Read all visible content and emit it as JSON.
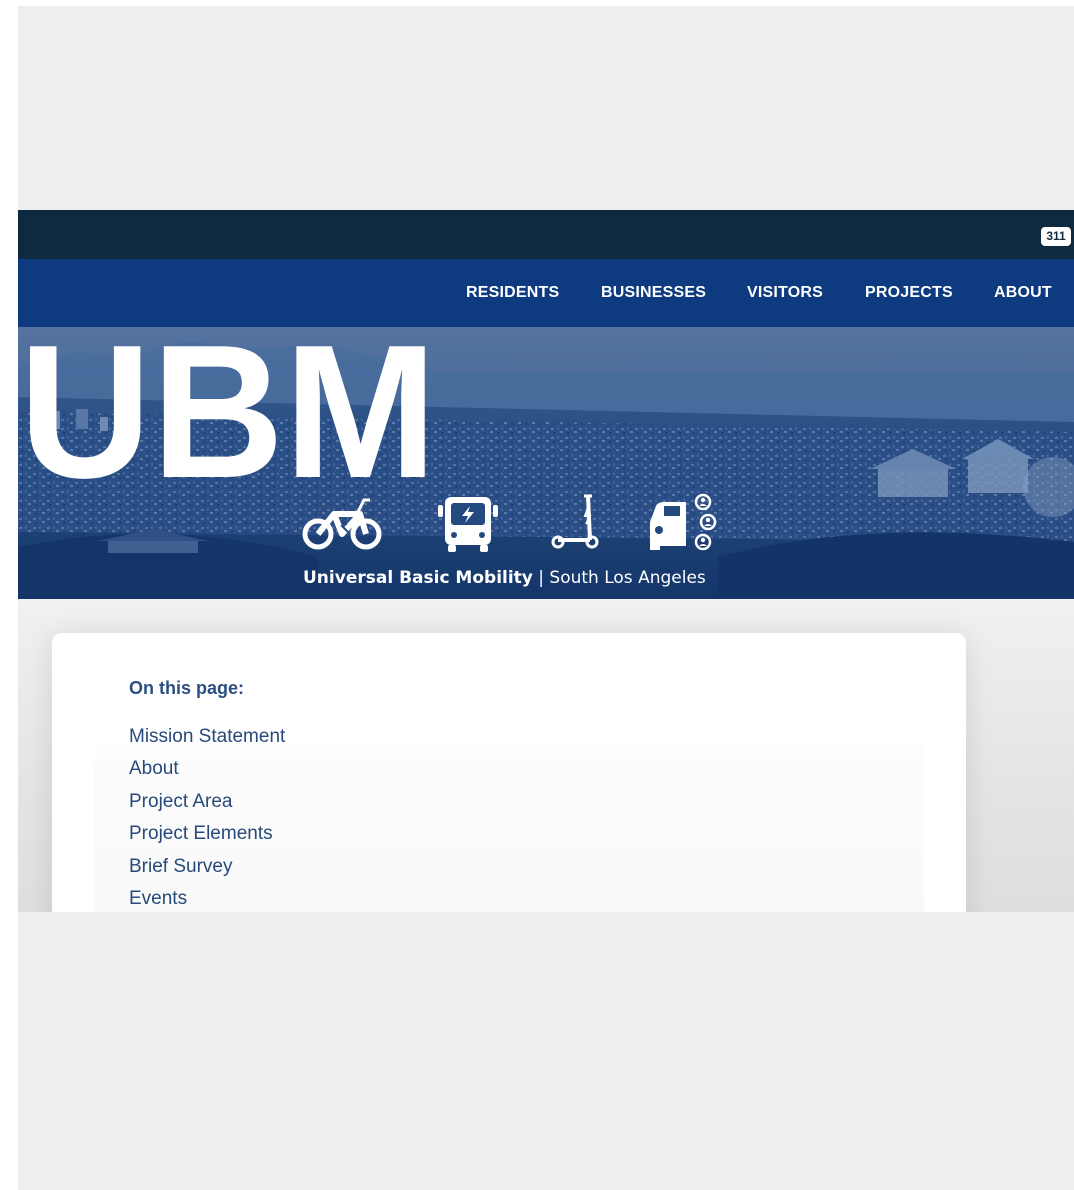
{
  "utility_bar": {
    "badge_311": "311"
  },
  "nav": {
    "items": [
      {
        "label": "RESIDENTS"
      },
      {
        "label": "BUSINESSES"
      },
      {
        "label": "VISITORS"
      },
      {
        "label": "PROJECTS"
      },
      {
        "label": "ABOUT"
      }
    ]
  },
  "hero": {
    "logo_text": "UBM",
    "caption_strong": "Universal Basic Mobility",
    "caption_rest": " | South Los Angeles",
    "icons": [
      "ebike-icon",
      "electric-bus-icon",
      "electric-scooter-icon",
      "car-share-icon"
    ]
  },
  "toc": {
    "title": "On this page:",
    "links": [
      {
        "label": "Mission Statement"
      },
      {
        "label": "About"
      },
      {
        "label": "Project Area"
      },
      {
        "label": "Project Elements"
      },
      {
        "label": "Brief Survey"
      },
      {
        "label": "Events"
      }
    ]
  },
  "colors": {
    "utility_bar": "#0d2a40",
    "nav_bar": "#0e3a80",
    "hero_tint": "#23497e",
    "link": "#27497a",
    "heading": "#2b4f82",
    "page_background": "#eeeeee"
  }
}
